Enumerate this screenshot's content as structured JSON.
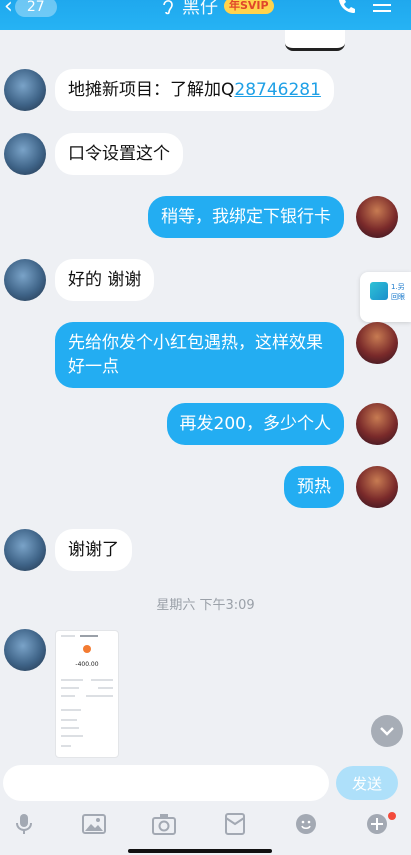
{
  "header": {
    "back_count": "27",
    "contact_name": "黑仔",
    "vip_badge": "年SVIP"
  },
  "messages": [
    {
      "side": "left",
      "text_prefix": "地摊新项目：了解加Q",
      "link": "28746281"
    },
    {
      "side": "left",
      "text": "口令设置这个"
    },
    {
      "side": "right",
      "text": "稍等，我绑定下银行卡"
    },
    {
      "side": "left",
      "text": "好的 谢谢"
    },
    {
      "side": "right",
      "text": "先给你发个小红包遇热，这样效果好一点"
    },
    {
      "side": "right",
      "text": "再发200，多少个人"
    },
    {
      "side": "right",
      "text": "预热"
    },
    {
      "side": "left",
      "text": "谢谢了"
    }
  ],
  "timestamp": "星期六 下午3:09",
  "receipt": {
    "amount": "-400.00"
  },
  "float_card": {
    "text": "1.另\n回眼"
  },
  "input": {
    "placeholder": "",
    "send_label": "发送"
  },
  "toolbar": [
    "voice-icon",
    "image-icon",
    "camera-icon",
    "red-packet-icon",
    "emoji-icon",
    "plus-icon"
  ],
  "colors": {
    "accent": "#23adf2",
    "header": "#1fa8ee",
    "background": "#eef0f4"
  }
}
